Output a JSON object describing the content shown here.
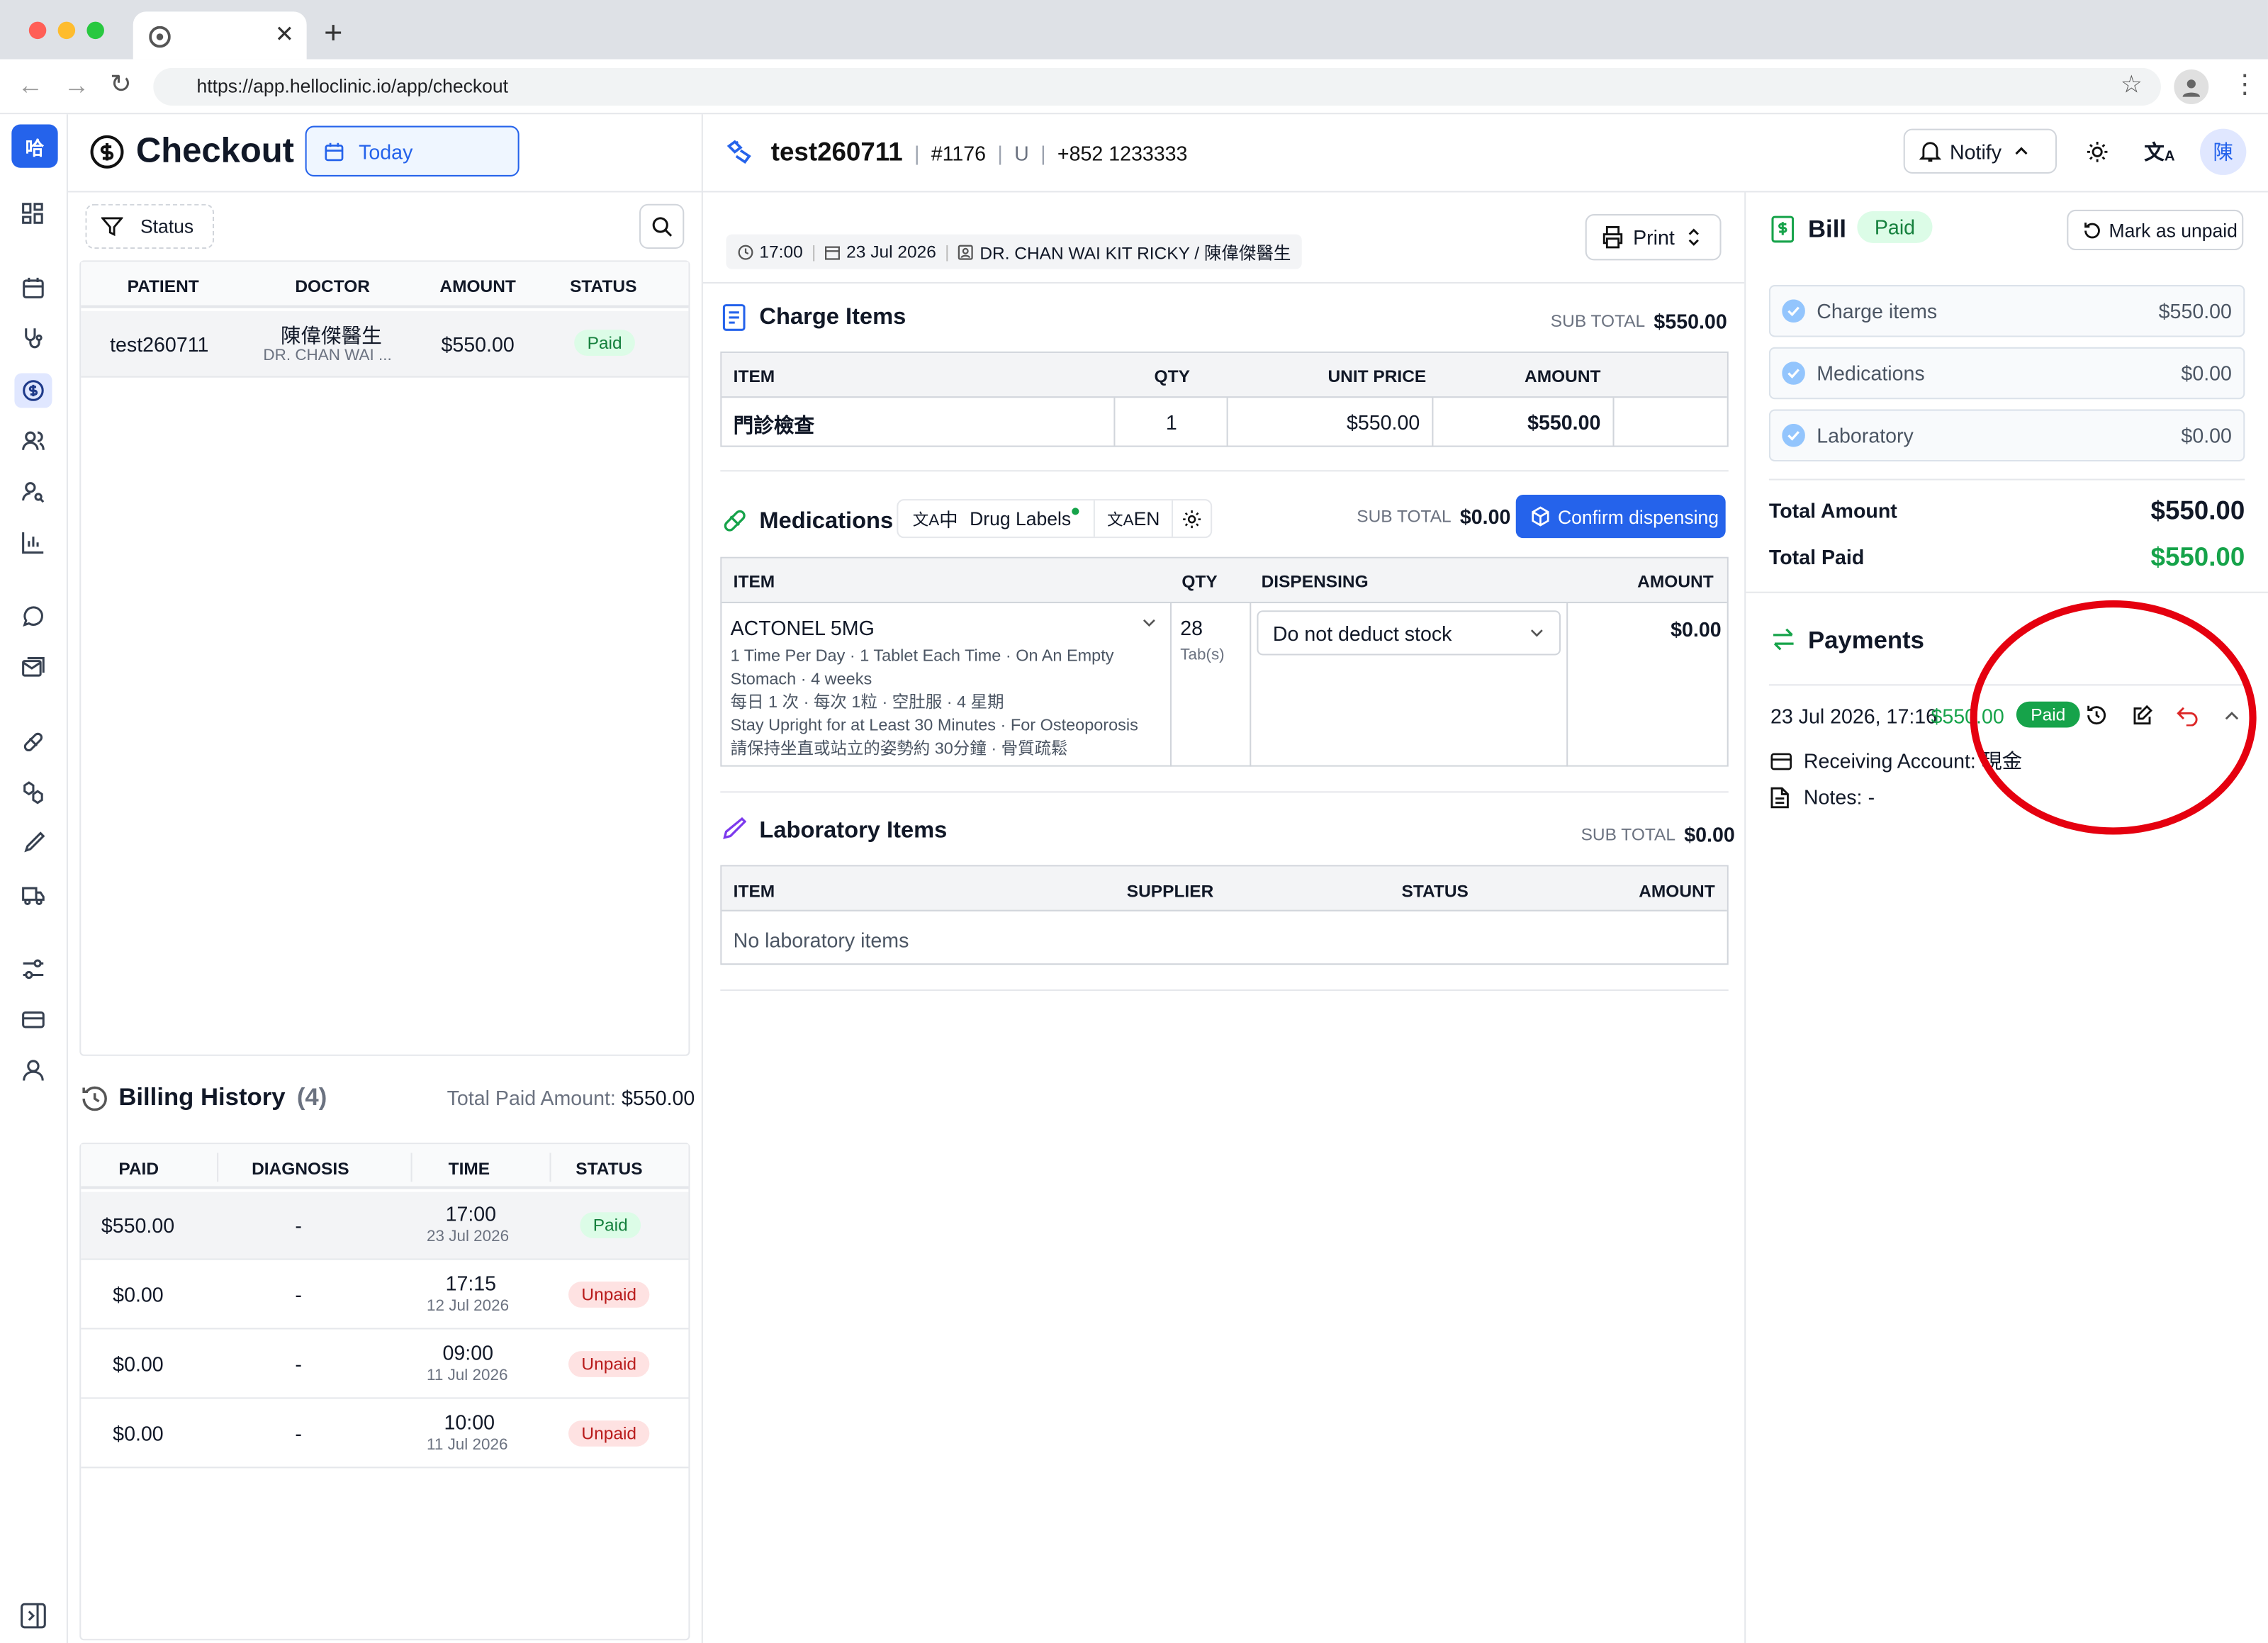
{
  "browser": {
    "url": "https://app.helloclinic.io/app/checkout"
  },
  "checkout": {
    "title": "Checkout",
    "date_filter": "Today",
    "status_filter": "Status",
    "columns": [
      "PATIENT",
      "DOCTOR",
      "AMOUNT",
      "STATUS"
    ],
    "row": {
      "patient": "test260711",
      "doctor": "陳偉傑醫生",
      "doctor_en": "DR. CHAN WAI ...",
      "amount": "$550.00",
      "status": "Paid"
    }
  },
  "billing_history": {
    "title": "Billing History",
    "count": "(4)",
    "total_label": "Total Paid Amount:",
    "total": "$550.00",
    "columns": [
      "PAID",
      "DIAGNOSIS",
      "TIME",
      "STATUS"
    ],
    "rows": [
      {
        "paid": "$550.00",
        "diag": "-",
        "time": "17:00",
        "date": "23 Jul 2026",
        "status": "Paid"
      },
      {
        "paid": "$0.00",
        "diag": "-",
        "time": "17:15",
        "date": "12 Jul 2026",
        "status": "Unpaid"
      },
      {
        "paid": "$0.00",
        "diag": "-",
        "time": "09:00",
        "date": "11 Jul 2026",
        "status": "Unpaid"
      },
      {
        "paid": "$0.00",
        "diag": "-",
        "time": "10:00",
        "date": "11 Jul 2026",
        "status": "Unpaid"
      }
    ]
  },
  "patient": {
    "name": "test260711",
    "id": "#1176",
    "gender": "U",
    "phone": "+852 1233333",
    "notify": "Notify",
    "avatar": "陳"
  },
  "visit": {
    "time": "17:00",
    "date": "23 Jul 2026",
    "doctor": "DR. CHAN WAI KIT RICKY / 陳偉傑醫生",
    "print": "Print"
  },
  "charge": {
    "title": "Charge Items",
    "sub_label": "SUB TOTAL",
    "sub_total": "$550.00",
    "columns": [
      "ITEM",
      "QTY",
      "UNIT PRICE",
      "AMOUNT"
    ],
    "row": {
      "item": "門診檢查",
      "qty": "1",
      "unit": "$550.00",
      "amount": "$550.00"
    }
  },
  "meds": {
    "title": "Medications",
    "lang_zh": "中",
    "drug_labels": "Drug Labels",
    "lang_en": "EN",
    "sub_label": "SUB TOTAL",
    "sub_total": "$0.00",
    "confirm": "Confirm dispensing",
    "columns": [
      "ITEM",
      "QTY",
      "DISPENSING",
      "AMOUNT"
    ],
    "row": {
      "name": "ACTONEL 5MG",
      "l1": "1 Time Per Day · 1 Tablet Each Time · On An Empty",
      "l2": "Stomach · 4 weeks",
      "l3": "每日 1 次 · 每次 1粒 · 空肚服 · 4 星期",
      "l4": "Stay Upright for at Least 30 Minutes · For Osteoporosis",
      "l5": "請保持坐直或站立的姿勢約 30分鐘 · 骨質疏鬆",
      "qty": "28",
      "unit": "Tab(s)",
      "dispensing": "Do not deduct stock",
      "amount": "$0.00"
    }
  },
  "lab": {
    "title": "Laboratory Items",
    "sub_label": "SUB TOTAL",
    "sub_total": "$0.00",
    "columns": [
      "ITEM",
      "SUPPLIER",
      "STATUS",
      "AMOUNT"
    ],
    "empty": "No laboratory items"
  },
  "bill": {
    "title": "Bill",
    "status": "Paid",
    "mark_unpaid": "Mark as unpaid",
    "items": [
      {
        "label": "Charge items",
        "value": "$550.00"
      },
      {
        "label": "Medications",
        "value": "$0.00"
      },
      {
        "label": "Laboratory",
        "value": "$0.00"
      }
    ],
    "total_amount_label": "Total Amount",
    "total_amount": "$550.00",
    "total_paid_label": "Total Paid",
    "total_paid": "$550.00"
  },
  "payments": {
    "title": "Payments",
    "datetime": "23 Jul 2026, 17:16",
    "amount": "$550.00",
    "status": "Paid",
    "account_label": "Receiving Account:",
    "account": "現金",
    "notes_label": "Notes:",
    "notes": "-"
  },
  "colors": {
    "accent": "#2563eb",
    "green": "#16a34a",
    "red_annotation": "#e5000f"
  }
}
